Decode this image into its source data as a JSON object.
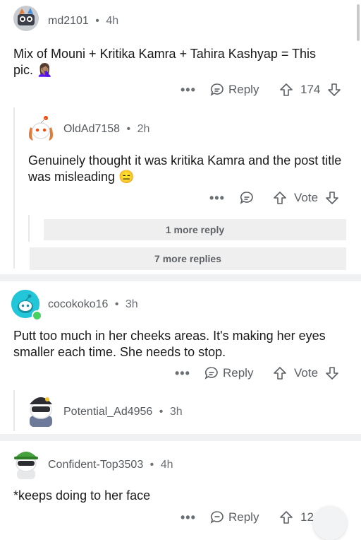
{
  "comments": [
    {
      "username": "md2101",
      "time": "4h",
      "text": "Mix of Mouni + Kritika Kamra + Tahira Kashyap = This pic.",
      "emoji": "🤦🏽‍♀️",
      "reply_label": "Reply",
      "vote_count": "174"
    },
    {
      "username": "OldAd7158",
      "time": "2h",
      "text": "Genuinely thought it was kritika Kamra and the post title was misleading",
      "emoji": "😑",
      "vote_label": "Vote"
    },
    {
      "username": "cocokoko16",
      "time": "3h",
      "text": "Putt too much in her cheeks areas. It's making her eyes smaller each time. She needs to stop.",
      "reply_label": "Reply",
      "vote_label": "Vote"
    },
    {
      "username": "Potential_Ad4956",
      "time": "3h"
    },
    {
      "username": "Confident-Top3503",
      "time": "4h",
      "text": "*keeps doing to her face",
      "reply_label": "Reply",
      "vote_count": "12"
    }
  ],
  "more_reply": "1 more reply",
  "more_replies": "7 more replies",
  "separator": "•",
  "menu_glyph": "•••",
  "colors": {
    "online": "#46d160",
    "avatar_teal": "#21c6d8",
    "divider": "#f0f1f2"
  }
}
